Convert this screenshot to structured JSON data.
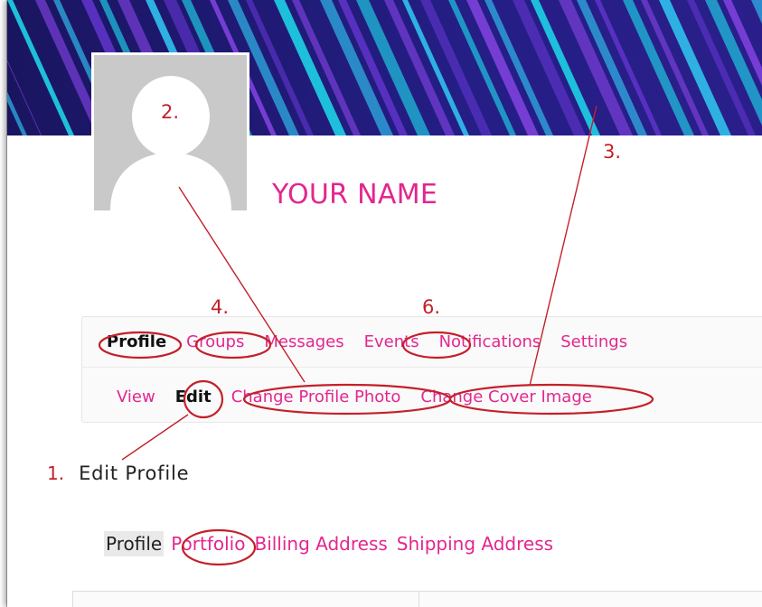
{
  "profile": {
    "name": "YOUR NAME"
  },
  "primary_nav": [
    {
      "label": "Profile",
      "active": true
    },
    {
      "label": "Groups",
      "active": false
    },
    {
      "label": "Messages",
      "active": false
    },
    {
      "label": "Events",
      "active": false
    },
    {
      "label": "Notifications",
      "active": false
    },
    {
      "label": "Settings",
      "active": false
    }
  ],
  "secondary_nav": [
    {
      "label": "View",
      "active": false
    },
    {
      "label": "Edit",
      "active": true
    },
    {
      "label": "Change Profile Photo",
      "active": false
    },
    {
      "label": "Change Cover Image",
      "active": false
    }
  ],
  "edit_section": {
    "number": "1.",
    "title": "Edit Profile"
  },
  "profile_tabs": [
    {
      "label": "Profile",
      "current": true
    },
    {
      "label": "Portfolio",
      "current": false
    },
    {
      "label": "Billing Address",
      "current": false
    },
    {
      "label": "Shipping Address",
      "current": false
    }
  ],
  "annotations": {
    "step_2": "2.",
    "step_3": "3.",
    "step_4": "4.",
    "step_6": "6."
  },
  "colors": {
    "accent": "#e2278f",
    "annotation": "#c4202a",
    "cover_bg": "#1f1a6e",
    "cover_stripe_cyan": "#1ec8e0",
    "cover_stripe_violet": "#7a3fd8"
  },
  "icons": {
    "avatar": "default-avatar-silhouette"
  }
}
